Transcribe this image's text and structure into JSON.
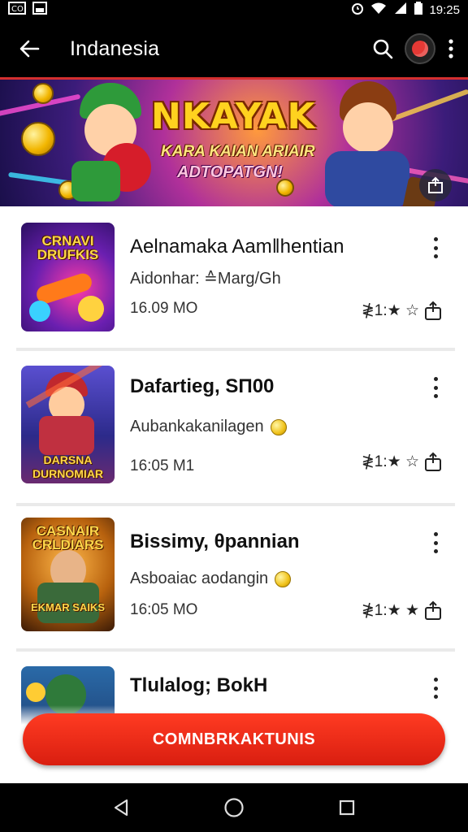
{
  "status_bar": {
    "time": "19:25",
    "left_icons": [
      "notification-icon",
      "image-icon"
    ],
    "right_icons": [
      "alarm-icon",
      "wifi-icon",
      "signal-icon",
      "battery-icon"
    ]
  },
  "app_bar": {
    "title": "Indanesia",
    "icons": [
      "back-arrow-icon",
      "search-icon",
      "avatar",
      "more-vert-icon"
    ],
    "accent_color": "#d32f2f"
  },
  "banner": {
    "title": "NKAYAK",
    "subtitle_1": "KARA KAIAN ARIAIR",
    "subtitle_2": "ADTOPATGN!",
    "fab_icon": "share-icon"
  },
  "items": [
    {
      "thumb_label": "CRNAVI DRUFKIS",
      "name": "Aelnamaka Aam‖hentian",
      "subtitle": "Aidonhar: ≙Marg/Gh",
      "size": "16.09 MO",
      "rating": "≹1:★ ☆",
      "has_coin": false,
      "bold": false
    },
    {
      "thumb_label": "DARSNA DURNOMIAR",
      "name": "Dafartieg, SΠ00",
      "subtitle": "Aubankakanilagen",
      "size": "16:05 M1",
      "rating": "≹1:★ ☆",
      "has_coin": true,
      "bold": true
    },
    {
      "thumb_label": "CASNAIR CRLDIARS",
      "thumb_label_2": "EKMAR SAIKS",
      "name": "Bissimy, θpannian",
      "subtitle": "Asboaiac aodangin",
      "size": "16:05 MΟ",
      "rating": "≹1:★ ★",
      "has_coin": true,
      "bold": true
    },
    {
      "name": "Tlulalog; BokH",
      "bold": true
    }
  ],
  "cta": {
    "label": "COMNBRKAKTUNIS",
    "color": "#e8291a"
  },
  "nav_bar": {
    "icons": [
      "back-triangle-icon",
      "home-circle-icon",
      "recents-square-icon"
    ]
  }
}
